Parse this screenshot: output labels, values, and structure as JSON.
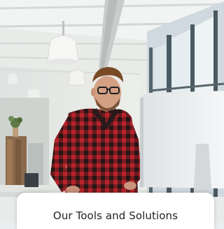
{
  "card": {
    "title": "Our Tools and Solutions"
  },
  "image": {
    "subject": "man-with-glasses-at-desktop-monitor"
  },
  "colors": {
    "ceiling": "#f2f4f3",
    "window_frame": "#4a5a62",
    "shirt_red": "#b8232b",
    "shirt_dark": "#241617",
    "card_bg": "#ffffff",
    "card_text": "#222222"
  }
}
